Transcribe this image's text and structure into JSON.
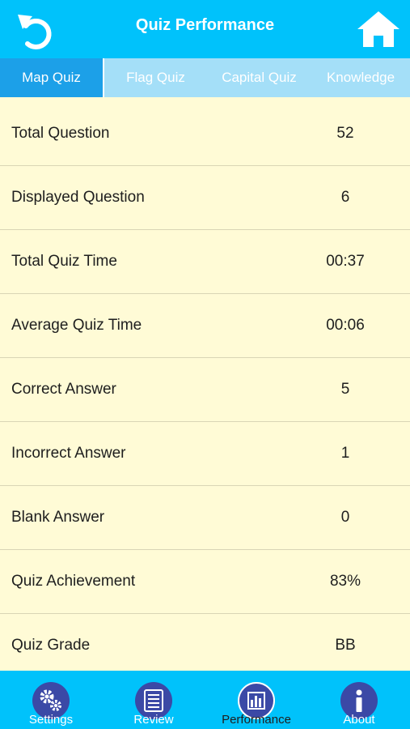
{
  "header": {
    "title": "Quiz Performance",
    "back_icon": "undo-arrow-icon",
    "home_icon": "home-icon"
  },
  "tabs": [
    {
      "label": "Map Quiz",
      "active": true
    },
    {
      "label": "Flag Quiz",
      "active": false
    },
    {
      "label": "Capital Quiz",
      "active": false
    },
    {
      "label": "Knowledge",
      "active": false
    }
  ],
  "stats": [
    {
      "label": "Total Question",
      "value": "52"
    },
    {
      "label": "Displayed Question",
      "value": "6"
    },
    {
      "label": "Total Quiz Time",
      "value": "00:37"
    },
    {
      "label": "Average Quiz Time",
      "value": "00:06"
    },
    {
      "label": "Correct Answer",
      "value": "5"
    },
    {
      "label": "Incorrect Answer",
      "value": "1"
    },
    {
      "label": "Blank Answer",
      "value": "0"
    },
    {
      "label": "Quiz Achievement",
      "value": "83%"
    },
    {
      "label": "Quiz Grade",
      "value": "BB"
    }
  ],
  "tabbar": [
    {
      "label": "Settings",
      "icon": "gears-icon",
      "active": false
    },
    {
      "label": "Review",
      "icon": "list-icon",
      "active": false
    },
    {
      "label": "Performance",
      "icon": "bar-chart-icon",
      "active": true
    },
    {
      "label": "About",
      "icon": "info-icon",
      "active": false
    }
  ],
  "colors": {
    "accent": "#00c2fb",
    "tab_active": "#1ca0e8",
    "tab_bg": "#a4dff8",
    "content_bg": "#fffbd6",
    "icon_bg": "#3b49a6"
  }
}
